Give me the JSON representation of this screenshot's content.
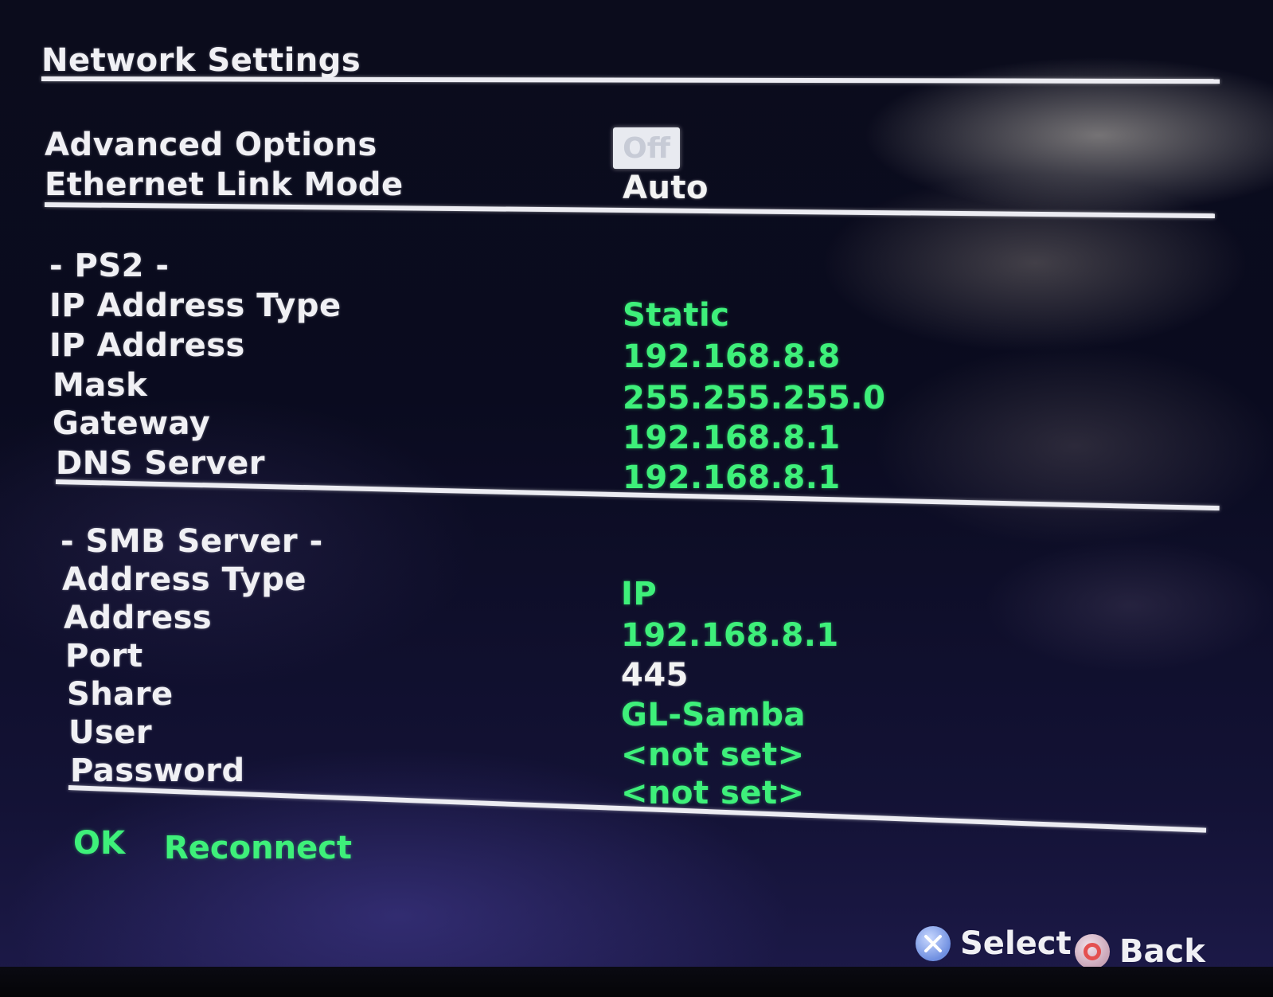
{
  "title": "Network Settings",
  "general": {
    "advanced_options_label": "Advanced Options",
    "advanced_options_value": "Off",
    "ethernet_link_mode_label": "Ethernet Link Mode",
    "ethernet_link_mode_value": "Auto"
  },
  "ps2": {
    "section_label": "- PS2 -",
    "ip_address_type_label": "IP Address Type",
    "ip_address_type_value": "Static",
    "ip_address_label": "IP Address",
    "ip_address_value": "192.168.8.8",
    "mask_label": "Mask",
    "mask_value": "255.255.255.0",
    "gateway_label": "Gateway",
    "gateway_value": "192.168.8.1",
    "dns_server_label": "DNS Server",
    "dns_server_value": "192.168.8.1"
  },
  "smb": {
    "section_label": "- SMB Server -",
    "address_type_label": "Address Type",
    "address_type_value": "IP",
    "address_label": "Address",
    "address_value": "192.168.8.1",
    "port_label": "Port",
    "port_value": "445",
    "share_label": "Share",
    "share_value": "GL-Samba",
    "user_label": "User",
    "user_value": "<not set>",
    "password_label": "Password",
    "password_value": "<not set>"
  },
  "actions": {
    "ok_label": "OK",
    "reconnect_label": "Reconnect"
  },
  "hints": {
    "select_label": "Select",
    "back_label": "Back"
  },
  "colors": {
    "value_green": "#3ef07a",
    "label_white": "#f0f0f4"
  }
}
